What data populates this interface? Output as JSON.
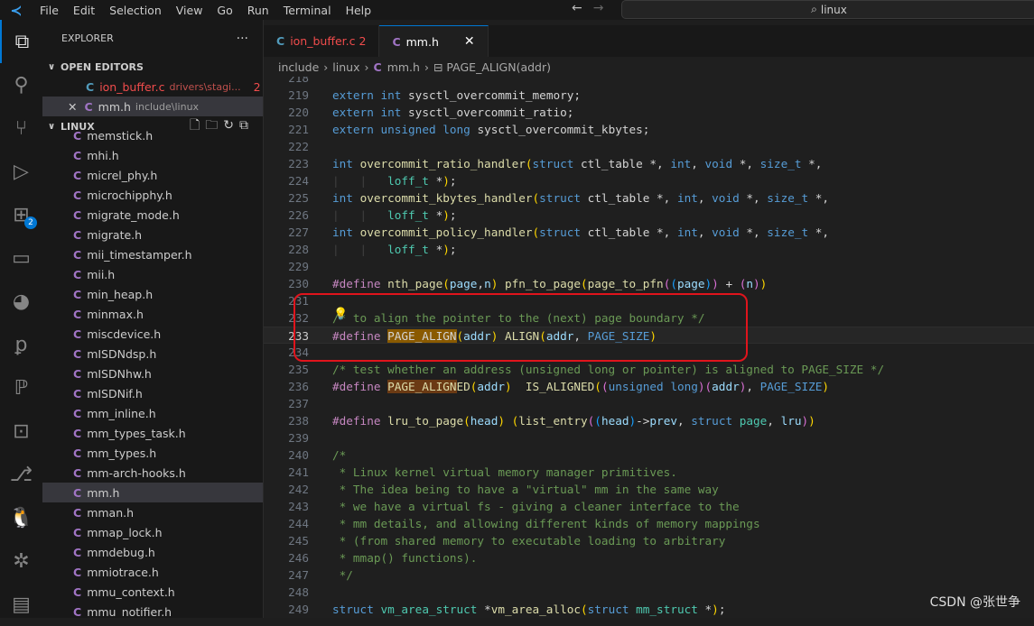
{
  "menu": [
    "File",
    "Edit",
    "Selection",
    "View",
    "Go",
    "Run",
    "Terminal",
    "Help"
  ],
  "search": "linux",
  "activity": [
    {
      "icon": "files-icon"
    },
    {
      "icon": "search-icon"
    },
    {
      "icon": "source-control-icon"
    },
    {
      "icon": "run-debug-icon"
    },
    {
      "icon": "extensions-icon",
      "badge": "2"
    },
    {
      "icon": "remote-explorer-icon"
    },
    {
      "icon": "pacman-icon"
    },
    {
      "icon": "python-icon"
    },
    {
      "icon": "p-icon"
    },
    {
      "icon": "terminal-icon"
    },
    {
      "icon": "git-graph-icon"
    },
    {
      "icon": "linux-icon"
    },
    {
      "icon": "rt-icon"
    },
    {
      "icon": "folder-icon"
    }
  ],
  "sidebar": {
    "title": "EXPLORER",
    "more": "···",
    "open_editors": "OPEN EDITORS",
    "editors": [
      {
        "icon": "C",
        "name": "ion_buffer.c",
        "desc": "drivers\\stagi...",
        "count": "2"
      },
      {
        "icon": "C",
        "name": "mm.h",
        "desc": "include\\linux"
      }
    ],
    "folder": "LINUX",
    "files": [
      "memstick.h",
      "mhi.h",
      "micrel_phy.h",
      "microchipphy.h",
      "migrate_mode.h",
      "migrate.h",
      "mii_timestamper.h",
      "mii.h",
      "min_heap.h",
      "minmax.h",
      "miscdevice.h",
      "mISDNdsp.h",
      "mISDNhw.h",
      "mISDNif.h",
      "mm_inline.h",
      "mm_types_task.h",
      "mm_types.h",
      "mm-arch-hooks.h",
      "mm.h",
      "mman.h",
      "mmap_lock.h",
      "mmdebug.h",
      "mmiotrace.h",
      "mmu_context.h",
      "mmu_notifier.h"
    ],
    "selected": "mm.h"
  },
  "tabs": [
    {
      "name": "ion_buffer.c",
      "count": "2",
      "error": true
    },
    {
      "name": "mm.h",
      "active": true
    }
  ],
  "breadcrumb": [
    "include",
    "linux",
    "mm.h",
    "PAGE_ALIGN(addr)"
  ],
  "current_line": 233,
  "code": [
    {
      "n": 218,
      "t": []
    },
    {
      "n": 219,
      "t": [
        [
          "kw",
          "extern "
        ],
        [
          "kw",
          "int "
        ],
        [
          "tx",
          "sysctl_overcommit_memory;"
        ]
      ]
    },
    {
      "n": 220,
      "t": [
        [
          "kw",
          "extern "
        ],
        [
          "kw",
          "int "
        ],
        [
          "tx",
          "sysctl_overcommit_ratio;"
        ]
      ]
    },
    {
      "n": 221,
      "t": [
        [
          "kw",
          "extern "
        ],
        [
          "kw",
          "unsigned "
        ],
        [
          "kw",
          "long "
        ],
        [
          "tx",
          "sysctl_overcommit_kbytes;"
        ]
      ]
    },
    {
      "n": 222,
      "t": []
    },
    {
      "n": 223,
      "t": [
        [
          "kw",
          "int "
        ],
        [
          "fn",
          "overcommit_ratio_handler"
        ],
        [
          "b1",
          "("
        ],
        [
          "kw",
          "struct "
        ],
        [
          "tx",
          "ctl_table *, "
        ],
        [
          "kw",
          "int"
        ],
        [
          "tx",
          ", "
        ],
        [
          "kw",
          "void "
        ],
        [
          "tx",
          "*, "
        ],
        [
          "kw",
          "size_t "
        ],
        [
          "tx",
          "*,"
        ]
      ]
    },
    {
      "n": 224,
      "t": [
        [
          "ig",
          "|   |   "
        ],
        [
          "ty",
          "loff_t "
        ],
        [
          "tx",
          "*"
        ],
        [
          "b1",
          ")"
        ],
        [
          "tx",
          ";"
        ]
      ]
    },
    {
      "n": 225,
      "t": [
        [
          "kw",
          "int "
        ],
        [
          "fn",
          "overcommit_kbytes_handler"
        ],
        [
          "b1",
          "("
        ],
        [
          "kw",
          "struct "
        ],
        [
          "tx",
          "ctl_table *, "
        ],
        [
          "kw",
          "int"
        ],
        [
          "tx",
          ", "
        ],
        [
          "kw",
          "void "
        ],
        [
          "tx",
          "*, "
        ],
        [
          "kw",
          "size_t "
        ],
        [
          "tx",
          "*,"
        ]
      ]
    },
    {
      "n": 226,
      "t": [
        [
          "ig",
          "|   |   "
        ],
        [
          "ty",
          "loff_t "
        ],
        [
          "tx",
          "*"
        ],
        [
          "b1",
          ")"
        ],
        [
          "tx",
          ";"
        ]
      ]
    },
    {
      "n": 227,
      "t": [
        [
          "kw",
          "int "
        ],
        [
          "fn",
          "overcommit_policy_handler"
        ],
        [
          "b1",
          "("
        ],
        [
          "kw",
          "struct "
        ],
        [
          "tx",
          "ctl_table *, "
        ],
        [
          "kw",
          "int"
        ],
        [
          "tx",
          ", "
        ],
        [
          "kw",
          "void "
        ],
        [
          "tx",
          "*, "
        ],
        [
          "kw",
          "size_t "
        ],
        [
          "tx",
          "*,"
        ]
      ]
    },
    {
      "n": 228,
      "t": [
        [
          "ig",
          "|   |   "
        ],
        [
          "ty",
          "loff_t "
        ],
        [
          "tx",
          "*"
        ],
        [
          "b1",
          ")"
        ],
        [
          "tx",
          ";"
        ]
      ]
    },
    {
      "n": 229,
      "t": []
    },
    {
      "n": 230,
      "t": [
        [
          "mc",
          "#define "
        ],
        [
          "fn",
          "nth_page"
        ],
        [
          "b1",
          "("
        ],
        [
          "pa",
          "page"
        ],
        [
          "tx",
          ","
        ],
        [
          "pa",
          "n"
        ],
        [
          "b1",
          ")"
        ],
        [
          "tx",
          " "
        ],
        [
          "fn",
          "pfn_to_page"
        ],
        [
          "b1",
          "("
        ],
        [
          "fn",
          "page_to_pfn"
        ],
        [
          "b2",
          "("
        ],
        [
          "b3",
          "("
        ],
        [
          "pa",
          "page"
        ],
        [
          "b3",
          ")"
        ],
        [
          "b2",
          ")"
        ],
        [
          "tx",
          " + "
        ],
        [
          "b2",
          "("
        ],
        [
          "pa",
          "n"
        ],
        [
          "b2",
          ")"
        ],
        [
          "b1",
          ")"
        ]
      ]
    },
    {
      "n": 231,
      "t": []
    },
    {
      "n": 232,
      "t": [
        [
          "cm",
          "/* to align the pointer to the (next) page boundary */"
        ]
      ]
    },
    {
      "n": 233,
      "t": [
        [
          "mc",
          "#define "
        ],
        [
          "hl",
          "PAGE_ALIGN"
        ],
        [
          "b1",
          "("
        ],
        [
          "pa",
          "addr"
        ],
        [
          "b1",
          ")"
        ],
        [
          "tx",
          " "
        ],
        [
          "fn",
          "ALIGN"
        ],
        [
          "b1",
          "("
        ],
        [
          "pa",
          "addr"
        ],
        [
          "tx",
          ", "
        ],
        [
          "kw",
          "PAGE_SIZE"
        ],
        [
          "b1",
          ")"
        ]
      ]
    },
    {
      "n": 234,
      "t": []
    },
    {
      "n": 235,
      "t": [
        [
          "cm",
          "/* test whether an address (unsigned long or pointer) is aligned to PAGE_SIZE */"
        ]
      ]
    },
    {
      "n": 236,
      "t": [
        [
          "mc",
          "#define "
        ],
        [
          "fn hl2",
          "PAGE_ALIGN"
        ],
        [
          "fn",
          "ED"
        ],
        [
          "b1",
          "("
        ],
        [
          "pa",
          "addr"
        ],
        [
          "b1",
          ")"
        ],
        [
          "tx",
          "  "
        ],
        [
          "fn",
          "IS_ALIGNED"
        ],
        [
          "b1",
          "("
        ],
        [
          "b2",
          "("
        ],
        [
          "kw",
          "unsigned "
        ],
        [
          "kw",
          "long"
        ],
        [
          "b2",
          ")"
        ],
        [
          "b2",
          "("
        ],
        [
          "pa",
          "addr"
        ],
        [
          "b2",
          ")"
        ],
        [
          "tx",
          ", "
        ],
        [
          "kw",
          "PAGE_SIZE"
        ],
        [
          "b1",
          ")"
        ]
      ]
    },
    {
      "n": 237,
      "t": []
    },
    {
      "n": 238,
      "t": [
        [
          "mc",
          "#define "
        ],
        [
          "fn",
          "lru_to_page"
        ],
        [
          "b1",
          "("
        ],
        [
          "pa",
          "head"
        ],
        [
          "b1",
          ")"
        ],
        [
          "tx",
          " "
        ],
        [
          "b1",
          "("
        ],
        [
          "fn",
          "list_entry"
        ],
        [
          "b2",
          "("
        ],
        [
          "b3",
          "("
        ],
        [
          "pa",
          "head"
        ],
        [
          "b3",
          ")"
        ],
        [
          "tx",
          "->"
        ],
        [
          "pa",
          "prev"
        ],
        [
          "tx",
          ", "
        ],
        [
          "kw",
          "struct "
        ],
        [
          "ty",
          "page"
        ],
        [
          "tx",
          ", "
        ],
        [
          "pa",
          "lru"
        ],
        [
          "b2",
          ")"
        ],
        [
          "b1",
          ")"
        ]
      ]
    },
    {
      "n": 239,
      "t": []
    },
    {
      "n": 240,
      "t": [
        [
          "cm",
          "/*"
        ]
      ]
    },
    {
      "n": 241,
      "t": [
        [
          "cm",
          " * Linux kernel virtual memory manager primitives."
        ]
      ]
    },
    {
      "n": 242,
      "t": [
        [
          "cm",
          " * The idea being to have a \"virtual\" mm in the same way"
        ]
      ]
    },
    {
      "n": 243,
      "t": [
        [
          "cm",
          " * we have a virtual fs - giving a cleaner interface to the"
        ]
      ]
    },
    {
      "n": 244,
      "t": [
        [
          "cm",
          " * mm details, and allowing different kinds of memory mappings"
        ]
      ]
    },
    {
      "n": 245,
      "t": [
        [
          "cm",
          " * (from shared memory to executable loading to arbitrary"
        ]
      ]
    },
    {
      "n": 246,
      "t": [
        [
          "cm",
          " * mmap() functions)."
        ]
      ]
    },
    {
      "n": 247,
      "t": [
        [
          "cm",
          " */"
        ]
      ]
    },
    {
      "n": 248,
      "t": []
    },
    {
      "n": 249,
      "t": [
        [
          "kw",
          "struct "
        ],
        [
          "ty",
          "vm_area_struct "
        ],
        [
          "tx",
          "*"
        ],
        [
          "fn",
          "vm_area_alloc"
        ],
        [
          "b1",
          "("
        ],
        [
          "kw",
          "struct "
        ],
        [
          "ty",
          "mm_struct "
        ],
        [
          "tx",
          "*"
        ],
        [
          "b1",
          ")"
        ],
        [
          "tx",
          ";"
        ]
      ]
    }
  ],
  "watermark": "CSDN @张世争",
  "colors": {
    "accent": "#0078d4",
    "error": "#f14c4c",
    "annotation_box": "#e0141c",
    "c_icon": "#519aba",
    "h_icon": "#a074c4"
  }
}
